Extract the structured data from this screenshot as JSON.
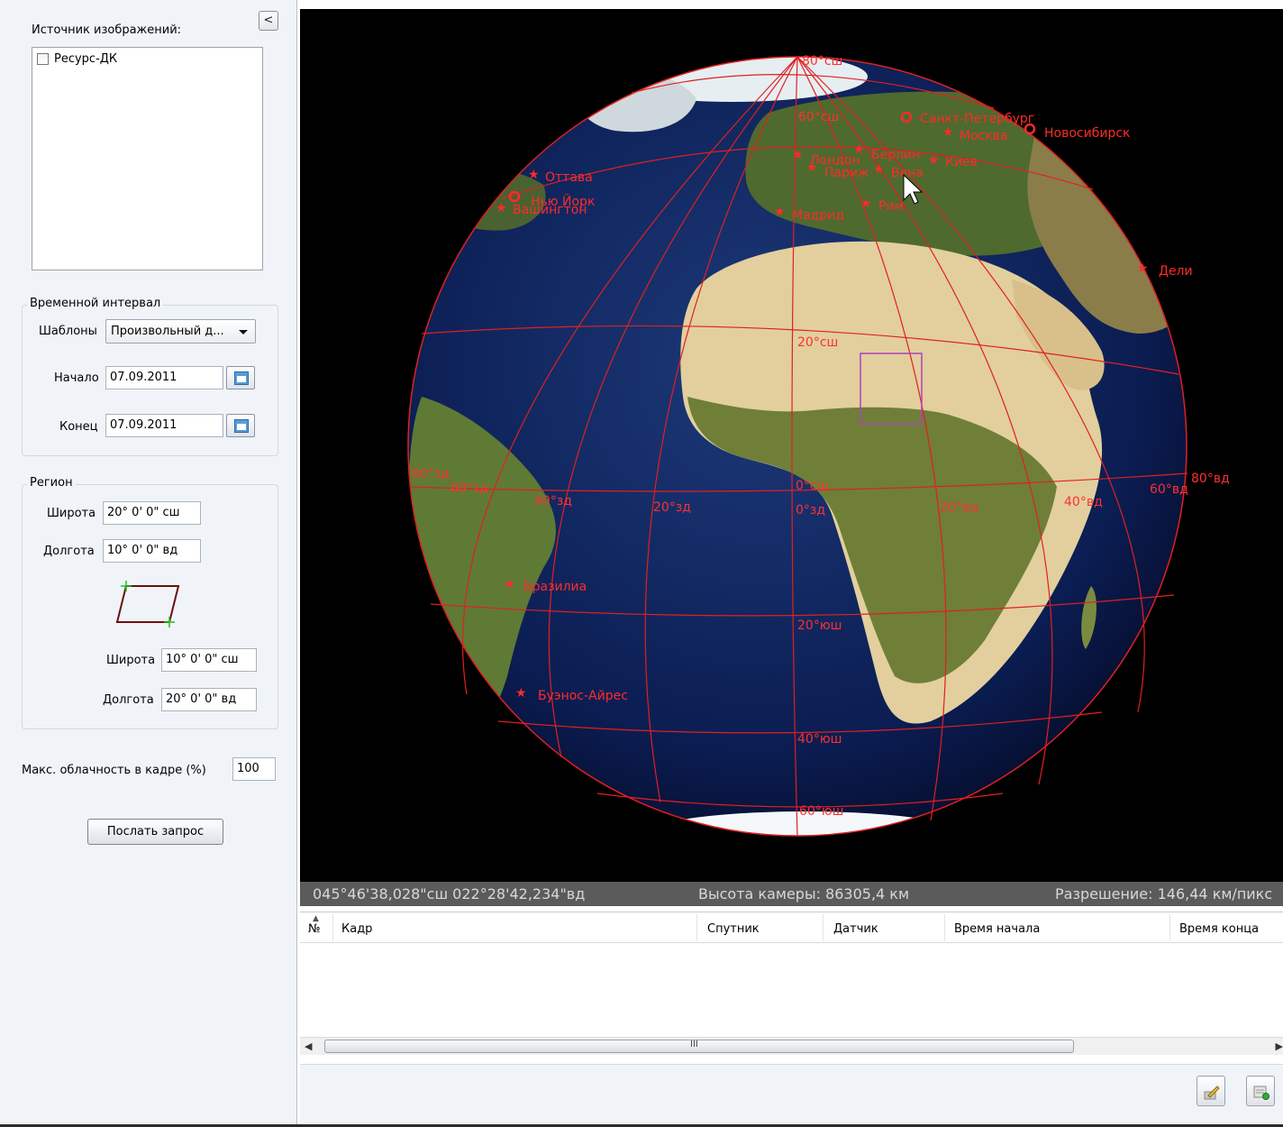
{
  "source": {
    "label": "Источник изображений:",
    "items": [
      {
        "label": "Ресурс-ДК",
        "checked": false
      }
    ]
  },
  "collapse_label": "<",
  "time": {
    "group_title": "Временной интервал",
    "templates_label": "Шаблоны",
    "template_value": "Произвольный д...",
    "start_label": "Начало",
    "start_value": "07.09.2011",
    "end_label": "Конец",
    "end_value": "07.09.2011"
  },
  "region": {
    "group_title": "Регион",
    "lat1_label": "Широта",
    "lat1_value": "20° 0' 0\" сш",
    "lon1_label": "Долгота",
    "lon1_value": "10° 0' 0\" вд",
    "lat2_label": "Широта",
    "lat2_value": "10° 0' 0\" сш",
    "lon2_label": "Долгота",
    "lon2_value": "20° 0' 0\" вд"
  },
  "cloud": {
    "label": "Макс. облачность в кадре (%)",
    "value": "100"
  },
  "query_button": "Послать запрос",
  "globe": {
    "grid_labels": {
      "lat80n": "80°сш",
      "lat60n": "60°сш",
      "lat20n": "20°сш",
      "lat0n": "0°сш",
      "lon0w": "0°зд",
      "lat20s": "20°юш",
      "lat40s": "40°юш",
      "lat60s": "60°юш",
      "lon80w": "80°зд",
      "lon60w": "60°зд",
      "lon40w": "40°зд",
      "lon20w": "20°зд",
      "lon20e": "20°вд",
      "lon40e": "40°вд",
      "lon60e": "60°вд",
      "lon80e": "80°вд"
    },
    "cities": {
      "st_petersburg": "Санкт-Петербург",
      "moscow": "Москва",
      "novosibirsk": "Новосибирск",
      "kiev": "Киев",
      "berlin": "Берлин",
      "paris": "Париж",
      "vienna": "Вена",
      "london": "Лондон",
      "rome": "Рим",
      "madrid": "Мадрид",
      "ottawa": "Оттава",
      "new_york": "Нью Йорк",
      "washington": "Вашингтон",
      "delhi": "Дели",
      "brasilia": "Бразилиа",
      "buenos_aires": "Буэнос-Айрес"
    }
  },
  "status": {
    "coordinates": "045°46'38,028\"сш  022°28'42,234\"вд",
    "camera_height": "Высота камеры: 86305,4 км",
    "resolution": "Разрешение: 146,44 км/пикс"
  },
  "table": {
    "columns": [
      "№",
      "Кадр",
      "Спутник",
      "Датчик",
      "Время начала",
      "Время конца"
    ],
    "rows": [],
    "scroll_grip": "III"
  },
  "colors": {
    "grid": "#e02020",
    "ocean": "#0a1a4a",
    "land": "#e5d3a3",
    "vegetation": "#6b7e36",
    "rivers": "#2a3cff",
    "city": "#ff2a2a"
  },
  "icons": {
    "collapse": "chevron-left-icon",
    "calendar": "calendar-icon",
    "edit": "pencil-icon",
    "export": "export-icon"
  }
}
